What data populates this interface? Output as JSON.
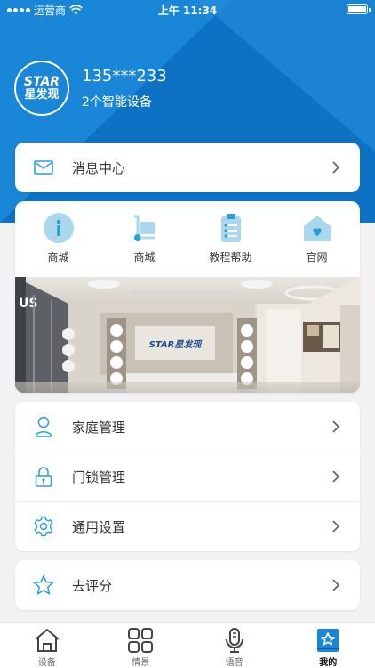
{
  "status_bar": {
    "carrier": "运营商",
    "time": "上午 11:34"
  },
  "profile": {
    "logo_top": "STAR",
    "logo_bottom": "星发现",
    "phone": "135***233",
    "devices": "2个智能设备"
  },
  "message_center": {
    "label": "消息中心"
  },
  "quick_links": [
    {
      "label": "商城",
      "icon": "info-icon"
    },
    {
      "label": "商城",
      "icon": "cart-icon"
    },
    {
      "label": "教程帮助",
      "icon": "clipboard-icon"
    },
    {
      "label": "官网",
      "icon": "home-heart-icon"
    }
  ],
  "banner": {
    "sign_text": "STAR星发现",
    "wall_text": "US"
  },
  "settings": [
    {
      "label": "家庭管理",
      "icon": "user-icon"
    },
    {
      "label": "门锁管理",
      "icon": "lock-icon"
    },
    {
      "label": "通用设置",
      "icon": "gear-icon"
    }
  ],
  "rate": {
    "label": "去评分",
    "icon": "star-icon"
  },
  "tabs": [
    {
      "label": "设备",
      "icon": "house-icon"
    },
    {
      "label": "情景",
      "icon": "grid-icon"
    },
    {
      "label": "语音",
      "icon": "microphone-icon"
    },
    {
      "label": "我的",
      "icon": "profile-badge-icon",
      "active": true
    }
  ],
  "colors": {
    "header": "#0d72c4",
    "accent": "#1a86d8",
    "icon_blue": "#2a9fd6",
    "icon_light": "#a9d7ec"
  }
}
